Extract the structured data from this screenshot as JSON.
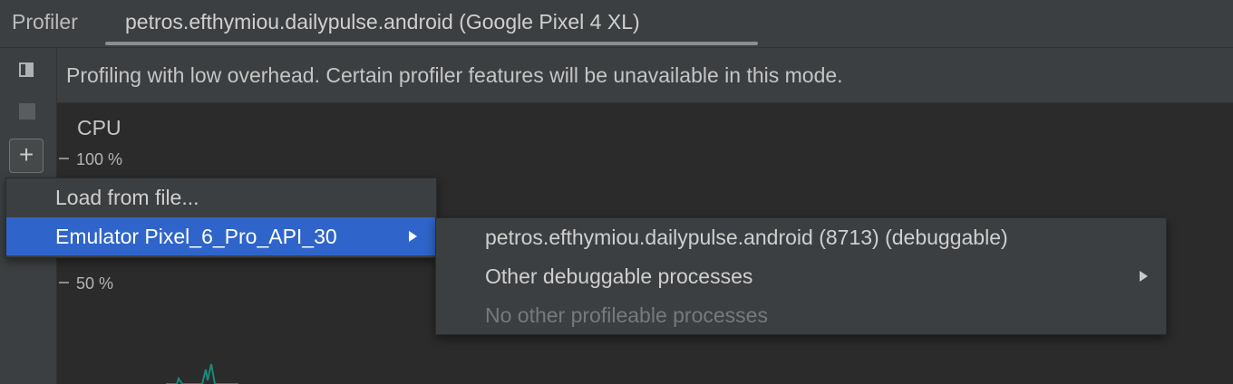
{
  "header": {
    "tool_title": "Profiler",
    "session_tab_label": "petros.efthymiou.dailypulse.android (Google Pixel 4 XL)"
  },
  "left_toolbar": {
    "buttons": [
      {
        "icon": "panel-toggle-icon"
      },
      {
        "icon": "stop-icon"
      },
      {
        "icon": "plus-icon",
        "glyph": "+"
      }
    ]
  },
  "banner": {
    "message": "Profiling with low overhead. Certain profiler features will be unavailable in this mode."
  },
  "monitor": {
    "title": "CPU",
    "ticks": [
      "100 %",
      "50 %"
    ]
  },
  "menu": {
    "items": [
      {
        "label": "Load from file...",
        "selected": false,
        "has_submenu": false
      },
      {
        "label": "Emulator Pixel_6_Pro_API_30",
        "selected": true,
        "has_submenu": true
      }
    ]
  },
  "submenu": {
    "items": [
      {
        "label": "petros.efthymiou.dailypulse.android (8713) (debuggable)",
        "enabled": true,
        "has_submenu": false
      },
      {
        "label": "Other debuggable processes",
        "enabled": true,
        "has_submenu": true
      },
      {
        "label": "No other profileable processes",
        "enabled": false,
        "has_submenu": false
      }
    ]
  },
  "colors": {
    "background": "#2b2b2b",
    "panel": "#3c3f41",
    "selection": "#2f65ca",
    "graph": "#1a8a7a"
  }
}
